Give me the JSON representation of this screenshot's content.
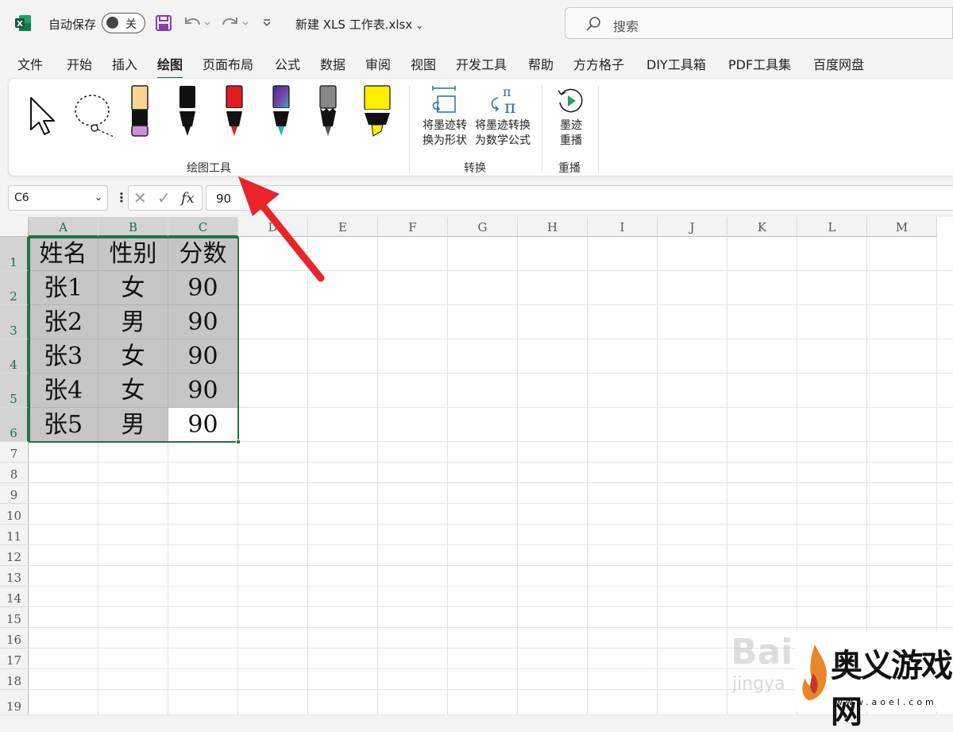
{
  "titlebar": {
    "autosave_label": "自动保存",
    "autosave_state": "关",
    "doc_title": "新建 XLS 工作表.xlsx",
    "search_placeholder": "搜索"
  },
  "tabs": [
    "文件",
    "开始",
    "插入",
    "绘图",
    "页面布局",
    "公式",
    "数据",
    "审阅",
    "视图",
    "开发工具",
    "帮助",
    "方方格子",
    "DIY工具箱",
    "PDF工具集",
    "百度网盘"
  ],
  "active_tab": "绘图",
  "ribbon": {
    "group_draw_label": "绘图工具",
    "group_convert_label": "转换",
    "group_replay_label": "重播",
    "ink_to_shape": [
      "将墨迹转",
      "换为形状"
    ],
    "ink_to_math": [
      "将墨迹转换",
      "为数学公式"
    ],
    "ink_replay": [
      "墨迹",
      "重播"
    ]
  },
  "formula_bar": {
    "name_box": "C6",
    "formula": "90"
  },
  "sheet": {
    "columns": [
      "A",
      "B",
      "C",
      "D",
      "E",
      "F",
      "G",
      "H",
      "I",
      "J",
      "K",
      "L",
      "M"
    ],
    "rows": [
      "1",
      "2",
      "3",
      "4",
      "5",
      "6",
      "7",
      "8",
      "9",
      "10",
      "11",
      "12",
      "13",
      "14",
      "15",
      "16",
      "17",
      "18",
      "19"
    ],
    "cells": [
      [
        "姓名",
        "性别",
        "分数"
      ],
      [
        "张1",
        "女",
        "90"
      ],
      [
        "张2",
        "男",
        "90"
      ],
      [
        "张3",
        "女",
        "90"
      ],
      [
        "张4",
        "女",
        "90"
      ],
      [
        "张5",
        "男",
        "90"
      ]
    ]
  },
  "watermarks": {
    "baidu": "Bai",
    "baidu_sub": "jingya",
    "site_name": "奥义游戏网",
    "site_url": "www.aoel.com"
  },
  "colors": {
    "excel_green": "#217346",
    "annotation_arrow": "#e8242a"
  }
}
